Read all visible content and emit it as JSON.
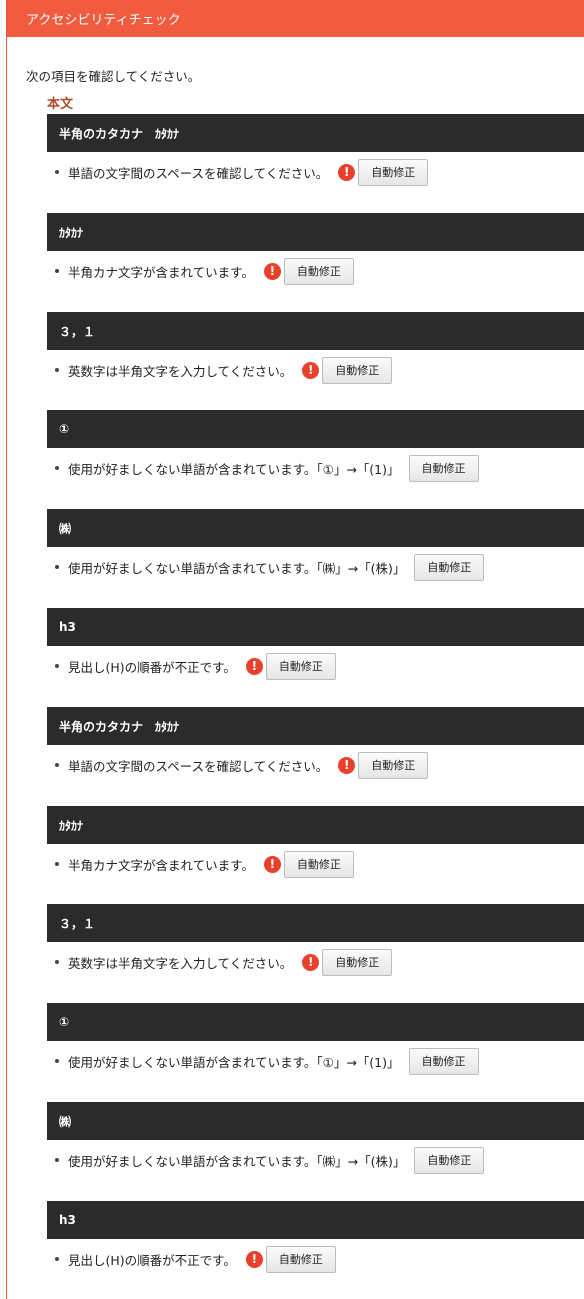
{
  "header": {
    "title": "アクセシビリティチェック"
  },
  "intro": "次の項目を確認してください。",
  "section": "本文",
  "fix_label": "自動修正",
  "items": [
    {
      "head": "半角のカタカナ　ｶﾀｶﾅ",
      "message": "単語の文字間のスペースを確認してください。",
      "warn": true
    },
    {
      "head": "ｶﾀｶﾅ",
      "message": "半角カナ文字が含まれています。",
      "warn": true
    },
    {
      "head": "３，１",
      "message": "英数字は半角文字を入力してください。",
      "warn": true
    },
    {
      "head": "①",
      "message": "使用が好ましくない単語が含まれています。「①」→「(1)」",
      "warn": false
    },
    {
      "head": "㈱",
      "message": "使用が好ましくない単語が含まれています。「㈱」→「(株)」",
      "warn": false
    },
    {
      "head": "h3",
      "message": "見出し(H)の順番が不正です。",
      "warn": true
    },
    {
      "head": "半角のカタカナ　ｶﾀｶﾅ",
      "message": "単語の文字間のスペースを確認してください。",
      "warn": true
    },
    {
      "head": "ｶﾀｶﾅ",
      "message": "半角カナ文字が含まれています。",
      "warn": true
    },
    {
      "head": "３，１",
      "message": "英数字は半角文字を入力してください。",
      "warn": true
    },
    {
      "head": "①",
      "message": "使用が好ましくない単語が含まれています。「①」→「(1)」",
      "warn": false
    },
    {
      "head": "㈱",
      "message": "使用が好ましくない単語が含まれています。「㈱」→「(株)」",
      "warn": false
    },
    {
      "head": "h3",
      "message": "見出し(H)の順番が不正です。",
      "warn": true
    }
  ]
}
